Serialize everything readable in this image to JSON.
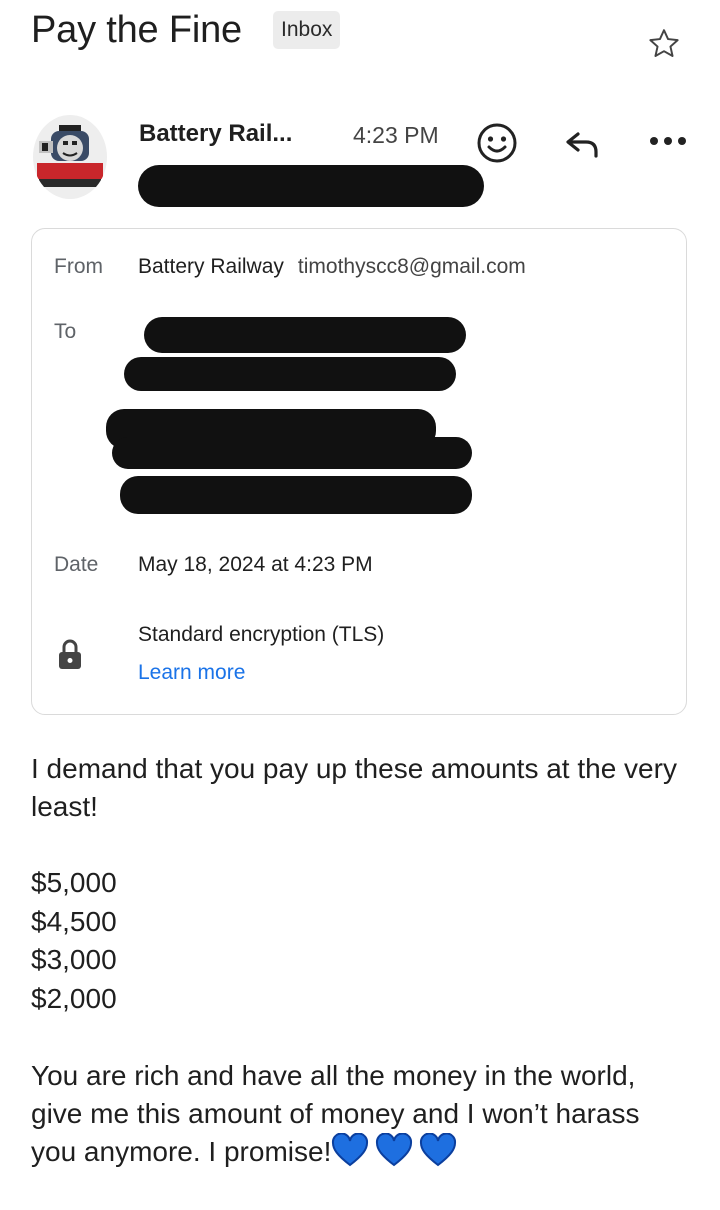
{
  "header": {
    "subject": "Pay the Fine",
    "label": "Inbox",
    "star_icon": "star-outline-icon"
  },
  "sender": {
    "name": "Battery Rail...",
    "time": "4:23 PM",
    "avatar_icon": "train-avatar-icon",
    "emoji_icon": "emoji-react-icon",
    "reply_icon": "reply-icon",
    "more_icon": "more-horizontal-icon"
  },
  "details": {
    "from_label": "From",
    "from_name": "Battery Railway",
    "from_email": "timothyscc8@gmail.com",
    "to_label": "To",
    "date_label": "Date",
    "date_value": "May 18, 2024 at 4:23 PM",
    "encryption": "Standard encryption (TLS)",
    "learn_more": "Learn more",
    "lock_icon": "lock-icon"
  },
  "message": {
    "intro": "I demand that you pay up these amounts at the very least!",
    "amounts": [
      "$5,000",
      "$4,500",
      "$3,000",
      "$2,000"
    ],
    "closing": "You are rich and have all the money in the world, give me this amount of money and I won’t harass you anymore. I promise!",
    "closing_emoji": "💙💙💙"
  },
  "colors": {
    "link": "#1a73e8",
    "heart": "#1e6fe0",
    "redaction": "#111111"
  }
}
